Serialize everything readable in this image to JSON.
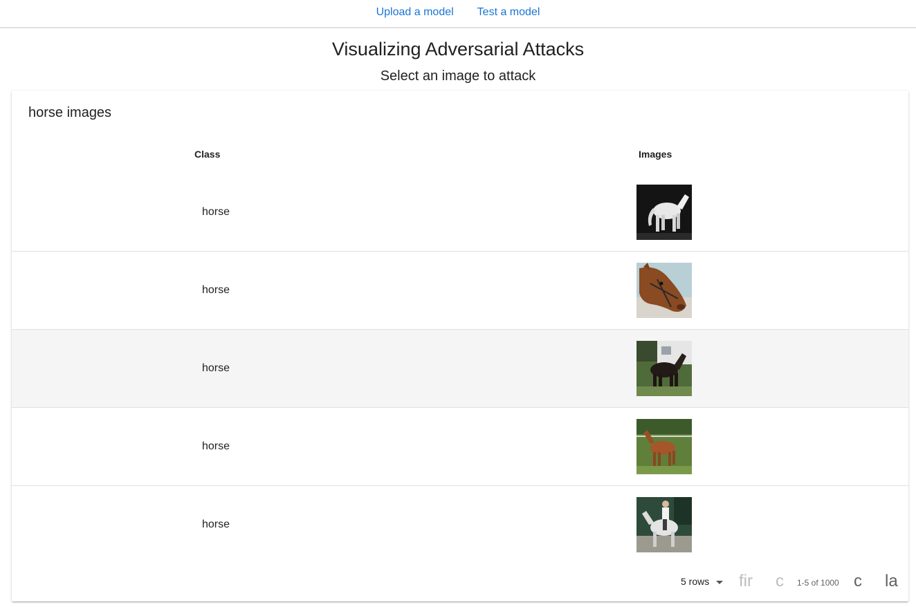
{
  "nav": {
    "upload_label": "Upload a model",
    "test_label": "Test a model"
  },
  "header": {
    "title": "Visualizing Adversarial Attacks",
    "subtitle": "Select an image to attack"
  },
  "table": {
    "title": "horse images",
    "columns": [
      "Class",
      "Images"
    ],
    "rows": [
      {
        "class": "horse",
        "image": "white horse on dark background"
      },
      {
        "class": "horse",
        "image": "brown horse head with bridle"
      },
      {
        "class": "horse",
        "image": "dark horse in front of trailer"
      },
      {
        "class": "horse",
        "image": "chestnut horse on grass"
      },
      {
        "class": "horse",
        "image": "rider on white horse"
      }
    ],
    "hover_row": 2
  },
  "pagination": {
    "rows_label": "5 rows",
    "first_label": "fir",
    "prev_label": "c",
    "range_label": "1-5 of 1000",
    "next_label": "c",
    "last_label": "la"
  },
  "colors": {
    "link": "#1976d2",
    "divider": "#e0e0e0",
    "hover_row": "#f5f5f5"
  }
}
